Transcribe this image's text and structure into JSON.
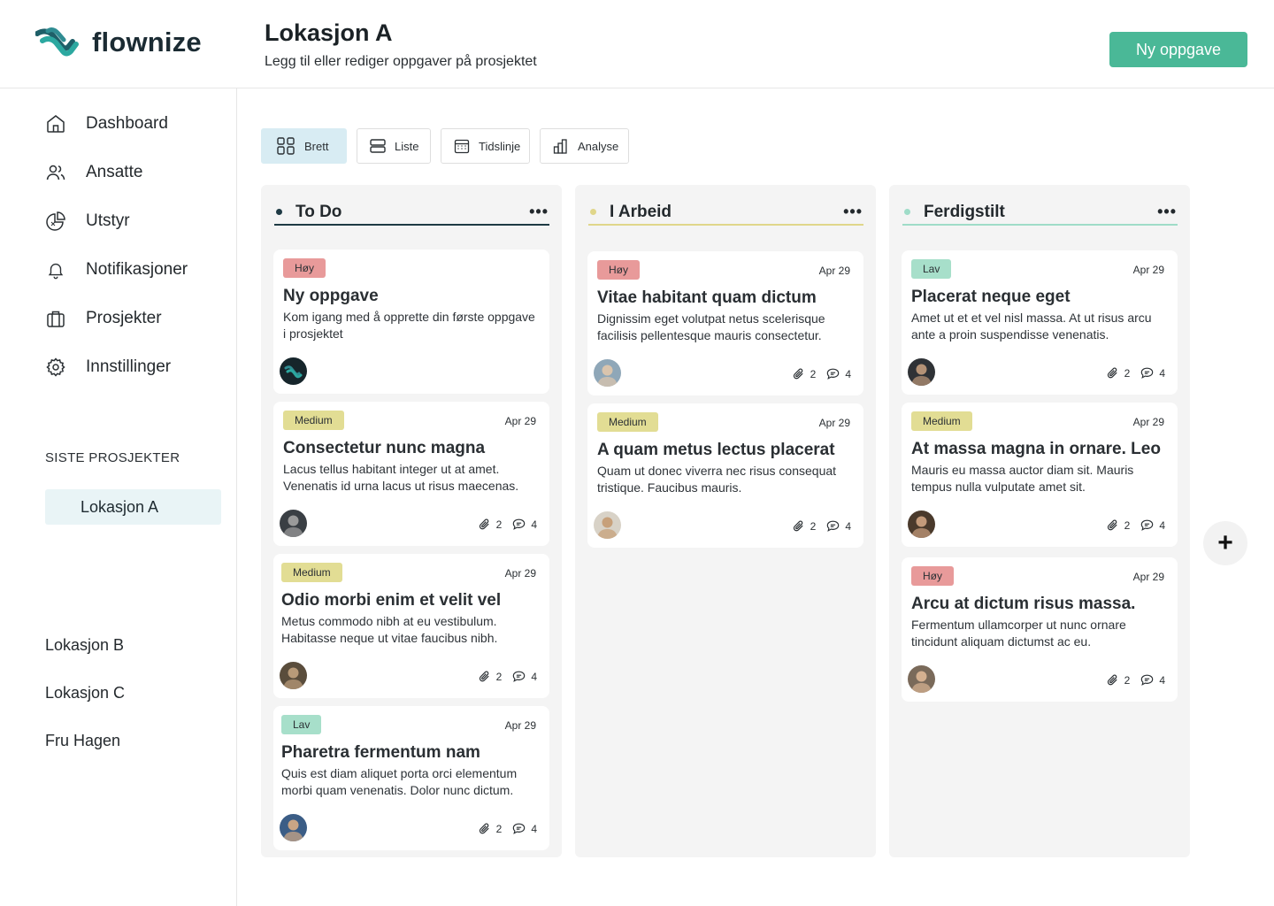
{
  "app": {
    "logo_text": "flownize",
    "brand_color": "#4ab897"
  },
  "header": {
    "title": "Lokasjon A",
    "subtitle": "Legg til eller rediger oppgaver på prosjektet",
    "new_task_label": "Ny oppgave"
  },
  "sidebar": {
    "items": [
      {
        "label": "Dashboard",
        "icon": "home-icon"
      },
      {
        "label": "Ansatte",
        "icon": "users-icon"
      },
      {
        "label": "Utstyr",
        "icon": "pie-chart-icon"
      },
      {
        "label": "Notifikasjoner",
        "icon": "bell-icon"
      },
      {
        "label": "Prosjekter",
        "icon": "briefcase-icon"
      },
      {
        "label": "Innstillinger",
        "icon": "gear-icon"
      }
    ],
    "recent_heading": "SISTE PROSJEKTER",
    "recent": [
      "Lokasjon A",
      "Lokasjon B",
      "Lokasjon C",
      "Fru Hagen"
    ]
  },
  "views": [
    {
      "label": "Brett",
      "icon": "grid-icon",
      "active": true
    },
    {
      "label": "Liste",
      "icon": "list-icon",
      "active": false
    },
    {
      "label": "Tidslinje",
      "icon": "calendar-icon",
      "active": false
    },
    {
      "label": "Analyse",
      "icon": "bar-chart-icon",
      "active": false
    }
  ],
  "columns": [
    {
      "title": "To Do",
      "menu": "•••",
      "color": "#1e3a44",
      "cards": [
        {
          "priority": "Høy",
          "date": "",
          "title": "Ny oppgave",
          "desc": "Kom igang med å opprette din første oppgave i prosjektet",
          "attachments": "",
          "comments": "",
          "avatar": "flownize-logo"
        },
        {
          "priority": "Medium",
          "date": "Apr 29",
          "title": "Consectetur nunc magna",
          "desc": "Lacus tellus habitant integer ut at amet. Venenatis id urna lacus ut risus maecenas.",
          "attachments": "2",
          "comments": "4",
          "avatar": "person"
        },
        {
          "priority": "Medium",
          "date": "Apr 29",
          "title": "Odio morbi enim et velit vel",
          "desc": "Metus commodo nibh at eu vestibulum. Habitasse neque ut vitae faucibus nibh.",
          "attachments": "2",
          "comments": "4",
          "avatar": "person"
        },
        {
          "priority": "Lav",
          "date": "Apr 29",
          "title": "Pharetra fermentum nam",
          "desc": "Quis est diam aliquet porta orci elementum morbi quam venenatis. Dolor nunc dictum.",
          "attachments": "2",
          "comments": "4",
          "avatar": "person"
        }
      ]
    },
    {
      "title": "I Arbeid",
      "menu": "•••",
      "color": "#e0d68a",
      "cards": [
        {
          "priority": "Høy",
          "date": "Apr 29",
          "title": "Vitae habitant quam dictum",
          "desc": "Dignissim eget volutpat netus scelerisque facilisis pellentesque mauris consectetur.",
          "attachments": "2",
          "comments": "4",
          "avatar": "person"
        },
        {
          "priority": "Medium",
          "date": "Apr 29",
          "title": "A quam metus lectus placerat",
          "desc": "Quam ut donec viverra nec risus consequat tristique. Faucibus mauris.",
          "attachments": "2",
          "comments": "4",
          "avatar": "person"
        }
      ]
    },
    {
      "title": "Ferdigstilt",
      "menu": "•••",
      "color": "#9fdcc8",
      "cards": [
        {
          "priority": "Lav",
          "date": "Apr 29",
          "title": "Placerat neque eget",
          "desc": "Amet ut et et vel nisl massa. At ut risus arcu ante a proin suspendisse venenatis.",
          "attachments": "2",
          "comments": "4",
          "avatar": "person"
        },
        {
          "priority": "Medium",
          "date": "Apr 29",
          "title": "At massa magna in ornare. Leo",
          "desc": "Mauris eu massa auctor diam sit. Mauris tempus nulla vulputate amet sit.",
          "attachments": "2",
          "comments": "4",
          "avatar": "person"
        },
        {
          "priority": "Høy",
          "date": "Apr 29",
          "title": "Arcu at dictum risus massa.",
          "desc": "Fermentum ullamcorper ut nunc ornare tincidunt aliquam dictumst ac eu.",
          "attachments": "2",
          "comments": "4",
          "avatar": "person"
        }
      ]
    }
  ],
  "priority_colors": {
    "Høy": "#e89a9a",
    "Medium": "#e2dd94",
    "Lav": "#a7dfca"
  },
  "add_column_label": "+"
}
